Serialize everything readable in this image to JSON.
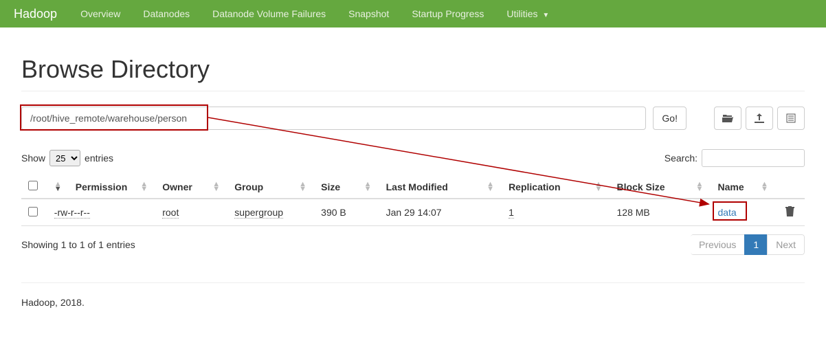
{
  "nav": {
    "brand": "Hadoop",
    "items": [
      "Overview",
      "Datanodes",
      "Datanode Volume Failures",
      "Snapshot",
      "Startup Progress",
      "Utilities"
    ]
  },
  "page_title": "Browse Directory",
  "path": "/root/hive_remote/warehouse/person",
  "go_label": "Go!",
  "show_label_prefix": "Show",
  "show_label_suffix": "entries",
  "entries_options": [
    "25"
  ],
  "entries_selected": "25",
  "search_label": "Search:",
  "columns": [
    "",
    "Permission",
    "Owner",
    "Group",
    "Size",
    "Last Modified",
    "Replication",
    "Block Size",
    "Name",
    ""
  ],
  "rows": [
    {
      "permission": "-rw-r--r--",
      "owner": "root",
      "group": "supergroup",
      "size": "390 B",
      "last_modified": "Jan 29 14:07",
      "replication": "1",
      "block_size": "128 MB",
      "name": "data"
    }
  ],
  "info_text": "Showing 1 to 1 of 1 entries",
  "pagination": {
    "previous": "Previous",
    "next": "Next",
    "current": "1"
  },
  "footer": "Hadoop, 2018."
}
